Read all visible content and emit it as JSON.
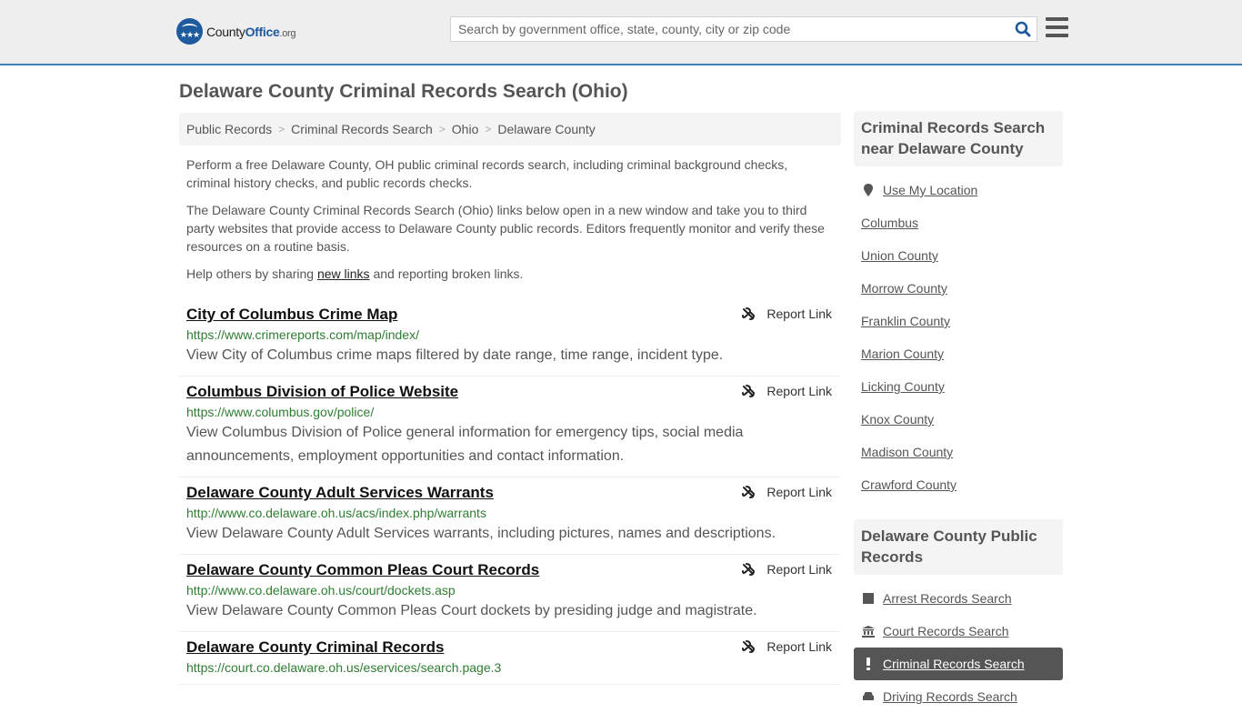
{
  "header": {
    "logo": {
      "county": "County",
      "office": "Office",
      "org": ".org"
    },
    "search_placeholder": "Search by government office, state, county, city or zip code"
  },
  "page_title": "Delaware County Criminal Records Search (Ohio)",
  "breadcrumb": [
    "Public Records",
    "Criminal Records Search",
    "Ohio",
    "Delaware County"
  ],
  "intro": {
    "p1": "Perform a free Delaware County, OH public criminal records search, including criminal background checks, criminal history checks, and public records checks.",
    "p2": "The Delaware County Criminal Records Search (Ohio) links below open in a new window and take you to third party websites that provide access to Delaware County public records. Editors frequently monitor and verify these resources on a routine basis.",
    "p3_before": "Help others by sharing ",
    "p3_link": "new links",
    "p3_after": " and reporting broken links."
  },
  "report_label": "Report Link",
  "links": [
    {
      "title": "City of Columbus Crime Map",
      "url": "https://www.crimereports.com/map/index/",
      "desc": "View City of Columbus crime maps filtered by date range, time range, incident type."
    },
    {
      "title": "Columbus Division of Police Website",
      "url": "https://www.columbus.gov/police/",
      "desc": "View Columbus Division of Police general information for emergency tips, social media announcements, employment opportunities and contact information."
    },
    {
      "title": "Delaware County Adult Services Warrants",
      "url": "http://www.co.delaware.oh.us/acs/index.php/warrants",
      "desc": "View Delaware County Adult Services warrants, including pictures, names and descriptions."
    },
    {
      "title": "Delaware County Common Pleas Court Records",
      "url": "http://www.co.delaware.oh.us/court/dockets.asp",
      "desc": "View Delaware County Common Pleas Court dockets by presiding judge and magistrate."
    },
    {
      "title": "Delaware County Criminal Records",
      "url": "https://court.co.delaware.oh.us/eservices/search.page.3",
      "desc": ""
    }
  ],
  "sidebar": {
    "nearby_title": "Criminal Records Search near Delaware County",
    "use_location": "Use My Location",
    "nearby": [
      "Columbus",
      "Union County",
      "Morrow County",
      "Franklin County",
      "Marion County",
      "Licking County",
      "Knox County",
      "Madison County",
      "Crawford County"
    ],
    "public_title": "Delaware County Public Records",
    "public": [
      {
        "label": "Arrest Records Search",
        "icon": "square-icon"
      },
      {
        "label": "Court Records Search",
        "icon": "courthouse-icon"
      },
      {
        "label": "Criminal Records Search",
        "icon": "exclamation-icon",
        "active": true
      },
      {
        "label": "Driving Records Search",
        "icon": "car-icon"
      }
    ]
  },
  "colors": {
    "accent": "#3f7fb8",
    "brand": "#1d5a9e",
    "url_green": "#2e7d32",
    "active_bg": "#555555"
  }
}
